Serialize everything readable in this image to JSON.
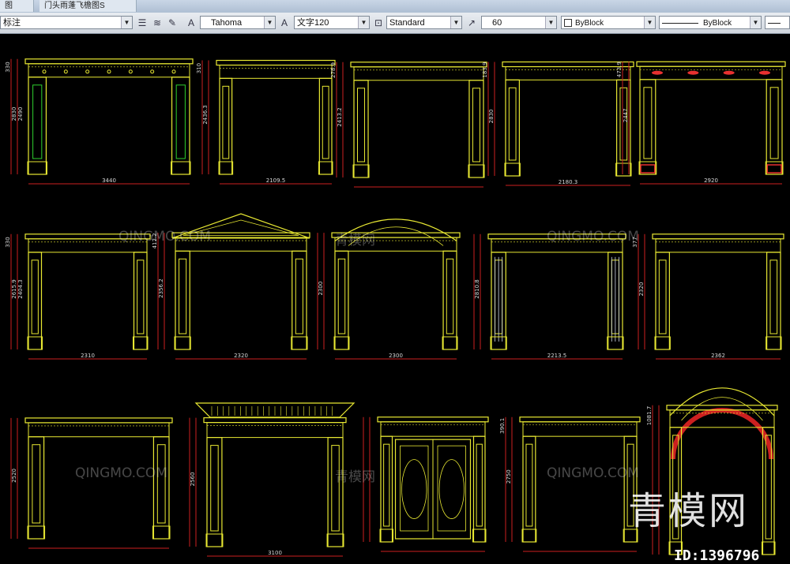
{
  "window": {
    "tabs": [
      "图",
      "门头雨蓬飞檐图S"
    ]
  },
  "toolbar": {
    "layer_value": "标注",
    "text_font": "Tahoma",
    "text_style": "文字120",
    "dim_style": "Standard",
    "scale_value": "60",
    "color_value": "ByBlock",
    "linetype_value": "ByBlock"
  },
  "icons": [
    "layer-manager-icon",
    "layer-states-icon",
    "text-style-icon",
    "dim-style-icon",
    "table-style-icon",
    "multileader-style-icon"
  ],
  "colors": {
    "frame_line": "#e8e832",
    "dimension_line": "#cc2020",
    "dimension_text": "#d8d8d8",
    "pillar_green": "#2ed12e",
    "accent_red": "#e83030",
    "background": "#000000"
  },
  "drawings": [
    {
      "id": "door-1",
      "width_label": "3440",
      "height_labels": [
        "330",
        "2830",
        "2490"
      ]
    },
    {
      "id": "door-2",
      "width_label": "2109.5",
      "height_labels": [
        "310",
        "2436.3"
      ]
    },
    {
      "id": "door-3",
      "width_label": "",
      "height_labels": [
        "278.9",
        "2413.2"
      ]
    },
    {
      "id": "door-4",
      "width_label": "2180.3",
      "height_labels": [
        "183.9",
        "2830"
      ]
    },
    {
      "id": "door-5",
      "width_label": "2920",
      "height_labels": [
        "473.9",
        "2447"
      ]
    },
    {
      "id": "door-6",
      "width_label": "2310",
      "height_labels": [
        "330",
        "2615.9",
        "2404.3"
      ]
    },
    {
      "id": "door-7",
      "width_label": "2320",
      "height_labels": [
        "412.2",
        "2356.2"
      ]
    },
    {
      "id": "door-8",
      "width_label": "2300",
      "height_labels": [
        "",
        "2300"
      ]
    },
    {
      "id": "door-9",
      "width_label": "2213.5",
      "height_labels": [
        "",
        "2810.8"
      ]
    },
    {
      "id": "door-10",
      "width_label": "2362",
      "height_labels": [
        "377",
        "2320"
      ]
    },
    {
      "id": "door-11",
      "width_label": "",
      "height_labels": [
        "",
        "2520"
      ]
    },
    {
      "id": "door-12",
      "width_label": "3100",
      "height_labels": [
        "",
        "2560"
      ]
    },
    {
      "id": "door-13",
      "width_label": "",
      "height_labels": [
        "",
        ""
      ]
    },
    {
      "id": "door-14",
      "width_label": "",
      "height_labels": [
        "390.1",
        "2750"
      ]
    },
    {
      "id": "door-15",
      "width_label": "",
      "height_labels": [
        "1081.7"
      ]
    }
  ],
  "watermarks": {
    "latin": "QINGMO.COM",
    "chinese": "青模网",
    "brand": "青模网",
    "id_text": "ID:1396796"
  }
}
